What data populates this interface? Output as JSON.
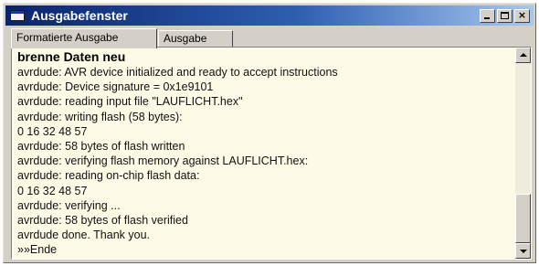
{
  "window": {
    "title": "Ausgabefenster",
    "title_icon": "window-icon",
    "controls": {
      "minimize": "minimize-icon",
      "maximize": "maximize-icon",
      "close_label": "×"
    }
  },
  "tabs": [
    {
      "label": "Formatierte Ausgabe",
      "active": true
    },
    {
      "label": "Ausgabe",
      "active": false
    }
  ],
  "output": {
    "heading": "brenne Daten neu",
    "lines": [
      "avrdude: AVR device initialized and ready to accept instructions",
      "avrdude: Device signature = 0x1e9101",
      "avrdude: reading input file \"LAUFLICHT.hex\"",
      "avrdude: writing flash (58 bytes):",
      "0 16 32 48 57",
      "avrdude: 58 bytes of flash written",
      "avrdude: verifying flash memory against LAUFLICHT.hex:",
      "avrdude: reading on-chip flash data:",
      "0 16 32 48 57",
      "avrdude: verifying ...",
      "avrdude: 58 bytes of flash verified",
      "avrdude done. Thank you.",
      "»»Ende"
    ]
  },
  "colors": {
    "titlebar_start": "#0a246a",
    "titlebar_end": "#a6c8f0",
    "output_background": "#fdfbe6"
  }
}
